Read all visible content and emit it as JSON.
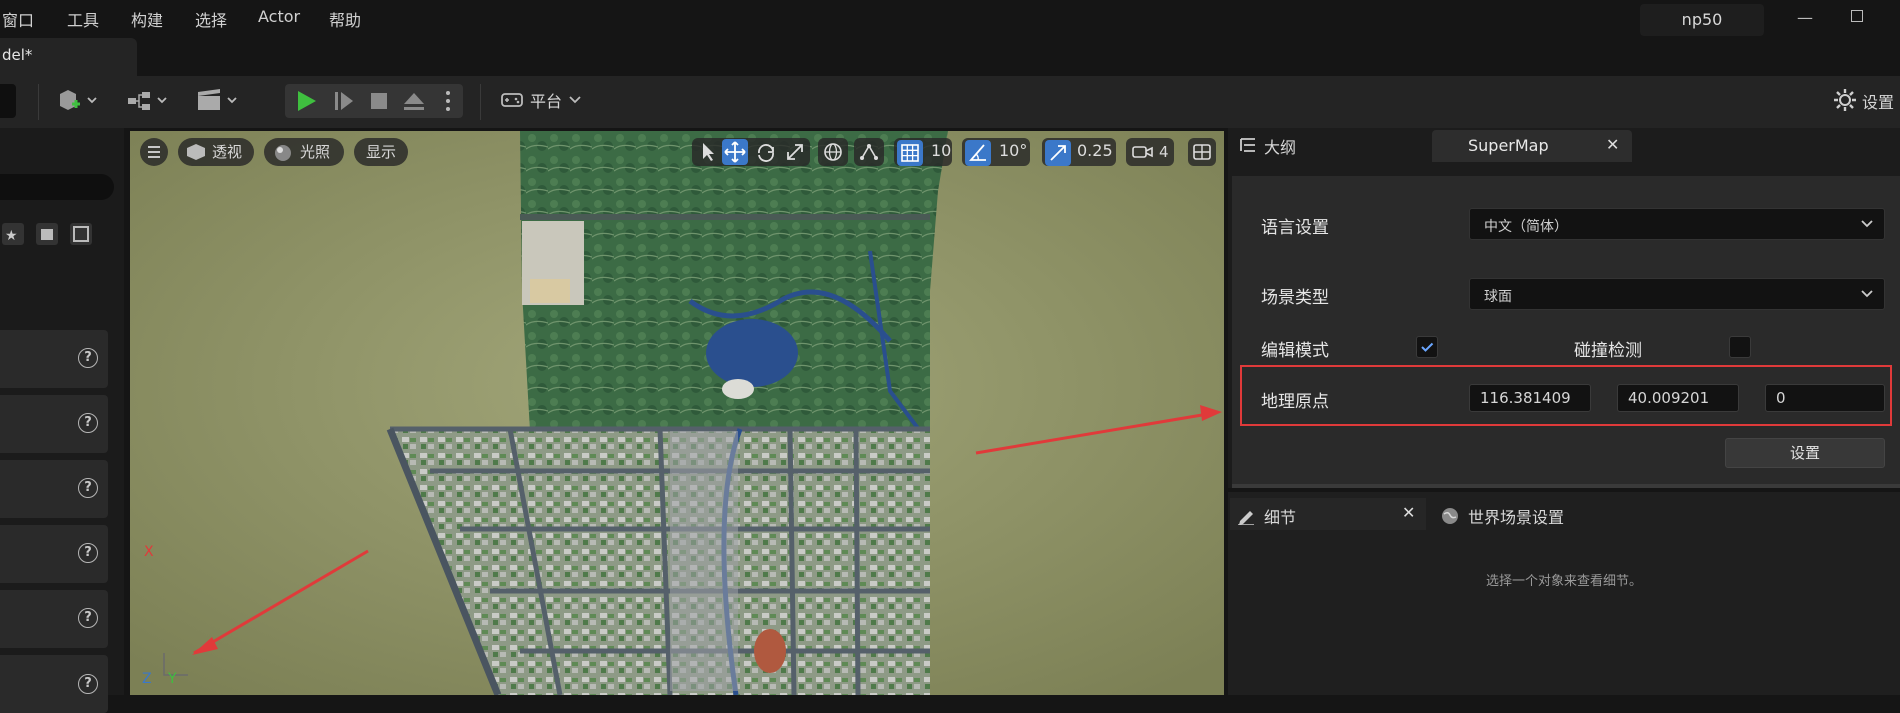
{
  "menubar": {
    "items": [
      "窗口",
      "工具",
      "构建",
      "选择",
      "Actor",
      "帮助"
    ],
    "project_name": "np50"
  },
  "doc_tab": {
    "label": "del*"
  },
  "toolbar": {
    "platform_label": "平台",
    "settings_label": "设置"
  },
  "viewport": {
    "perspective_label": "透视",
    "lighting_label": "光照",
    "show_label": "显示",
    "grid_snap_value": "10",
    "rotation_snap_value": "10°",
    "scale_snap_value": "0.25",
    "camera_speed_value": "4",
    "axis": {
      "x": "X",
      "y": "Y",
      "z": "Z"
    }
  },
  "right_top": {
    "outline_tab_label": "大纲",
    "supermap_tab_label": "SuperMap",
    "language_label": "语言设置",
    "language_value": "中文（简体）",
    "scene_type_label": "场景类型",
    "scene_type_value": "球面",
    "edit_mode_label": "编辑模式",
    "edit_mode_checked": true,
    "collision_label": "碰撞检测",
    "collision_checked": false,
    "geo_origin_label": "地理原点",
    "geo_origin": [
      "116.381409",
      "40.009201",
      "0"
    ],
    "set_button_label": "设置"
  },
  "right_bottom": {
    "details_tab_label": "细节",
    "world_settings_tab_label": "世界场景设置",
    "details_hint": "选择一个对象来查看细节。"
  },
  "colors": {
    "accent_blue": "#3b78c9",
    "highlight_red": "#e03a3a",
    "play_green": "#3fbf3f"
  }
}
